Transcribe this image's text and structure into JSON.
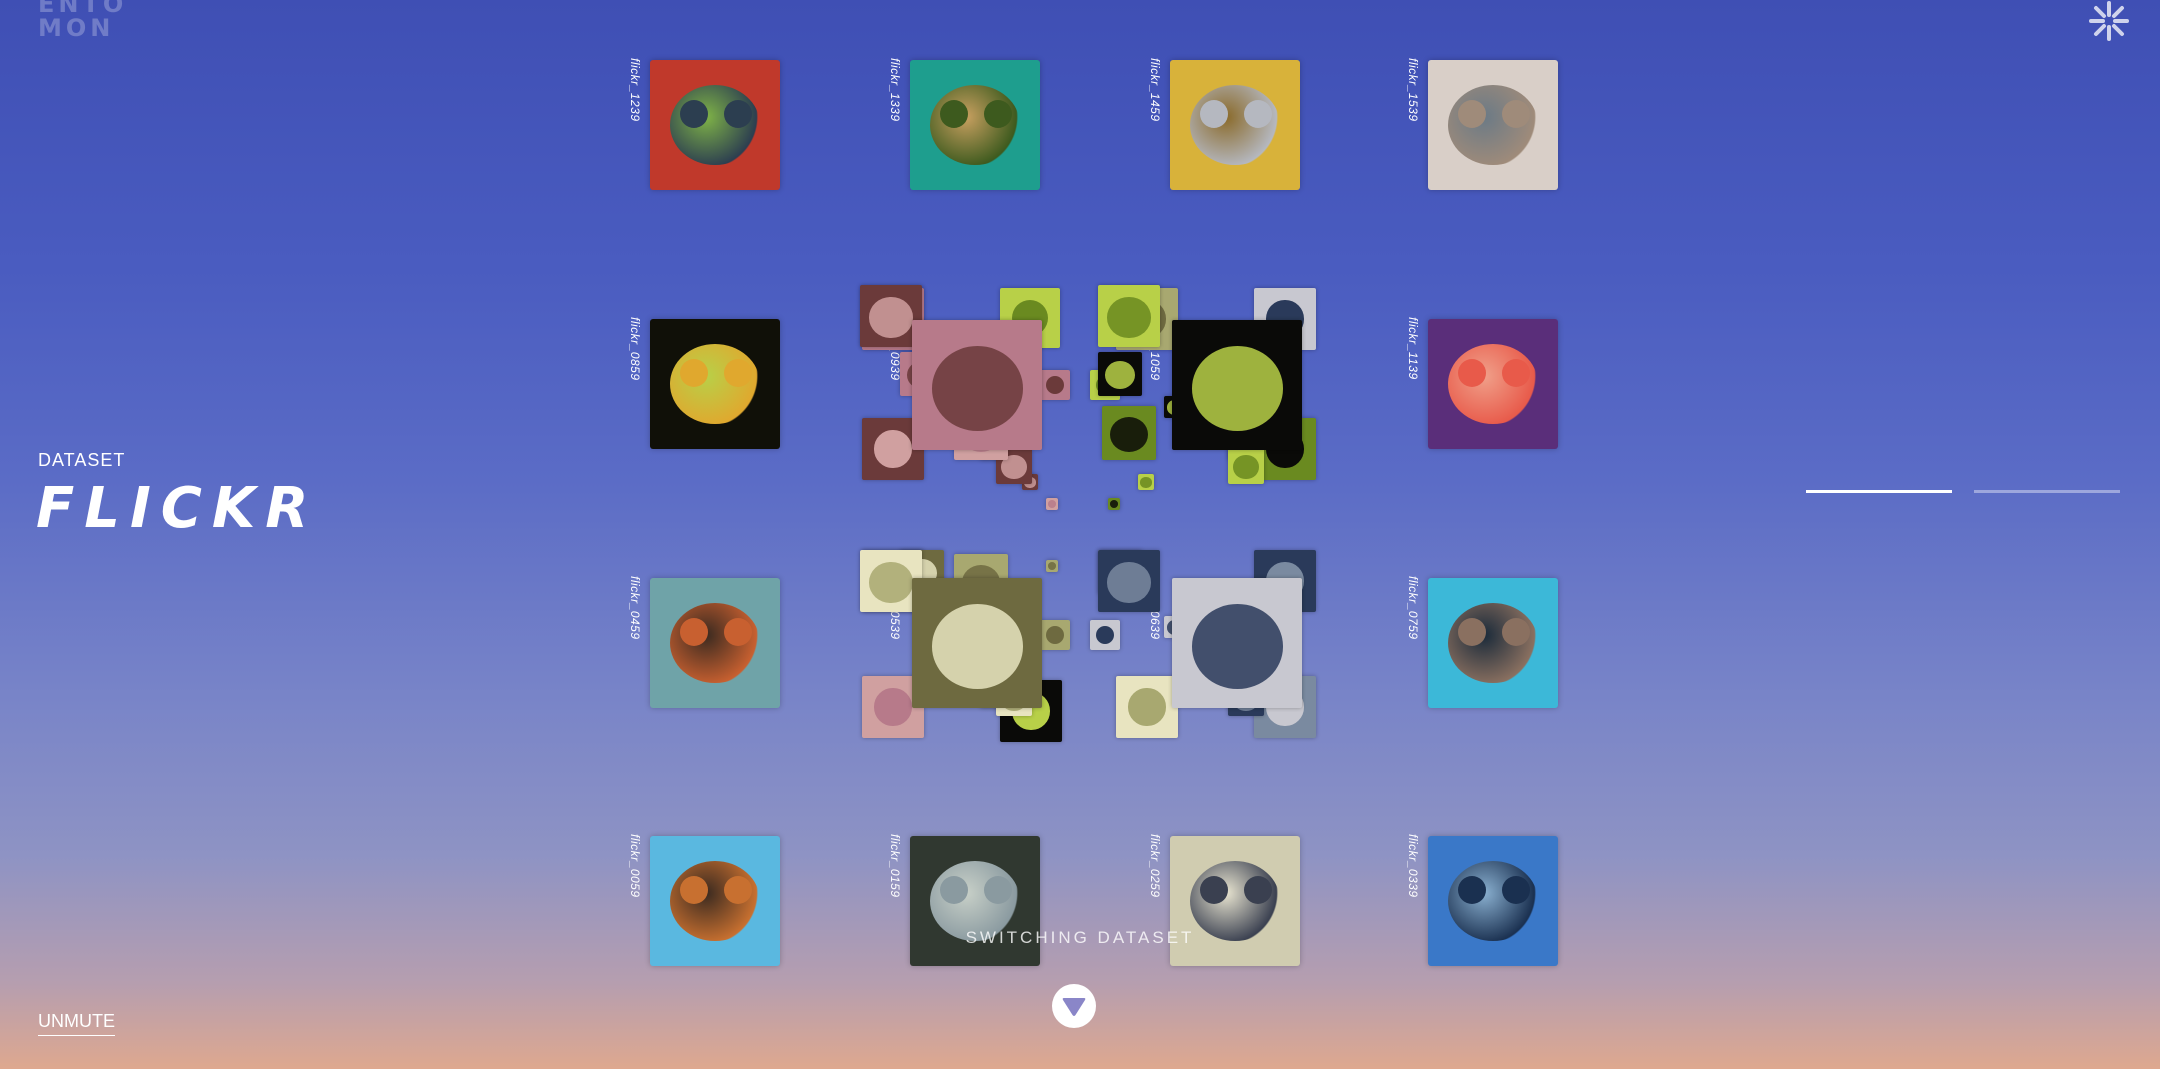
{
  "brand": {
    "logo_line1": "ENTO",
    "logo_line2": "MON"
  },
  "dataset": {
    "label": "DATASET",
    "name": "FLICKR"
  },
  "controls": {
    "unmute_label": "UNMUTE",
    "switching_label": "SWITCHING DATASET",
    "progress": [
      1.0,
      0.0
    ]
  },
  "grid": [
    {
      "label": "flickr_1239",
      "colors": [
        "#c0392b",
        "#2c3e50",
        "#7fb347"
      ]
    },
    {
      "label": "flickr_1339",
      "colors": [
        "#1e9e8e",
        "#3d5a1e",
        "#c8a060"
      ]
    },
    {
      "label": "flickr_1459",
      "colors": [
        "#d8b23a",
        "#b5b8c0",
        "#8a6a2a"
      ]
    },
    {
      "label": "flickr_1539",
      "colors": [
        "#d9cfc8",
        "#9f8b7a",
        "#6b7a86"
      ]
    },
    {
      "label": "flickr_0859",
      "colors": [
        "#101008",
        "#e0a82e",
        "#b8d048"
      ]
    },
    {
      "label": "flickr_0939",
      "colors": [
        "#b77a8a",
        "#6b3a3a",
        "#d0a0a0"
      ]
    },
    {
      "label": "flickr_1059",
      "colors": [
        "#0a0a08",
        "#b8d048",
        "#6a8a20"
      ]
    },
    {
      "label": "flickr_1139",
      "colors": [
        "#5a2e7a",
        "#e85a4a",
        "#f0a08a"
      ]
    },
    {
      "label": "flickr_0459",
      "colors": [
        "#6fa3a8",
        "#c86030",
        "#3a2a20"
      ]
    },
    {
      "label": "flickr_0539",
      "colors": [
        "#6e6a40",
        "#e8e4c0",
        "#a8a870"
      ]
    },
    {
      "label": "flickr_0639",
      "colors": [
        "#c8c8d0",
        "#2a3a5a",
        "#7a8aa0"
      ]
    },
    {
      "label": "flickr_0759",
      "colors": [
        "#3cb8d8",
        "#8a7060",
        "#1a2a3a"
      ]
    },
    {
      "label": "flickr_0059",
      "colors": [
        "#5ab8e0",
        "#c87030",
        "#3a2a20"
      ]
    },
    {
      "label": "flickr_0159",
      "colors": [
        "#303830",
        "#8a9aa0",
        "#c8d0c8"
      ]
    },
    {
      "label": "flickr_0259",
      "colors": [
        "#d0ccb0",
        "#3a4050",
        "#e8e4d0"
      ]
    },
    {
      "label": "flickr_0339",
      "colors": [
        "#3a78c8",
        "#1a3050",
        "#8ab0d0"
      ]
    }
  ]
}
